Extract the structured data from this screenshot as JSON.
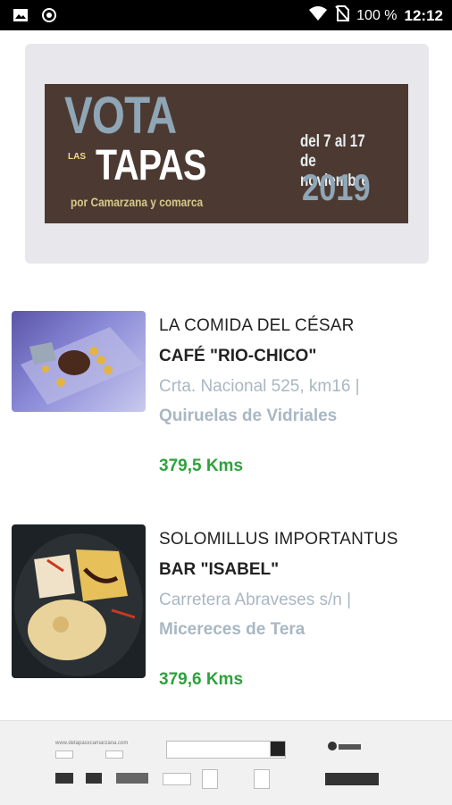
{
  "status_bar": {
    "battery": "100 %",
    "time": "12:12",
    "icons": [
      "image-icon",
      "record-icon",
      "wifi-icon",
      "no-sim-icon"
    ]
  },
  "banner": {
    "vota": "VOTA",
    "las": "LAS",
    "tapas": "TAPAS",
    "por": "por Camarzana y comarca",
    "dates_line1": "del 7 al 17",
    "dates_line2": "de noviembre",
    "year": "2019"
  },
  "items": [
    {
      "title": "LA COMIDA DEL CÉSAR",
      "place": "CAFÉ \"RIO-CHICO\"",
      "address": "Crta. Nacional 525, km16 |",
      "town": "Quiruelas de Vidriales",
      "distance": "379,5 Kms"
    },
    {
      "title": "SOLOMILLUS IMPORTANTUS",
      "place": "BAR \"ISABEL\"",
      "address": "Carretera Abraveses s/n |",
      "town": "Micereces de Tera",
      "distance": "379,6 Kms"
    }
  ],
  "footer": {
    "website": "www.detapasxcamarzana.com"
  },
  "colors": {
    "accent_green": "#2ea23c",
    "muted_blue": "#a9b7c4",
    "banner_brown": "#4c3a32"
  }
}
